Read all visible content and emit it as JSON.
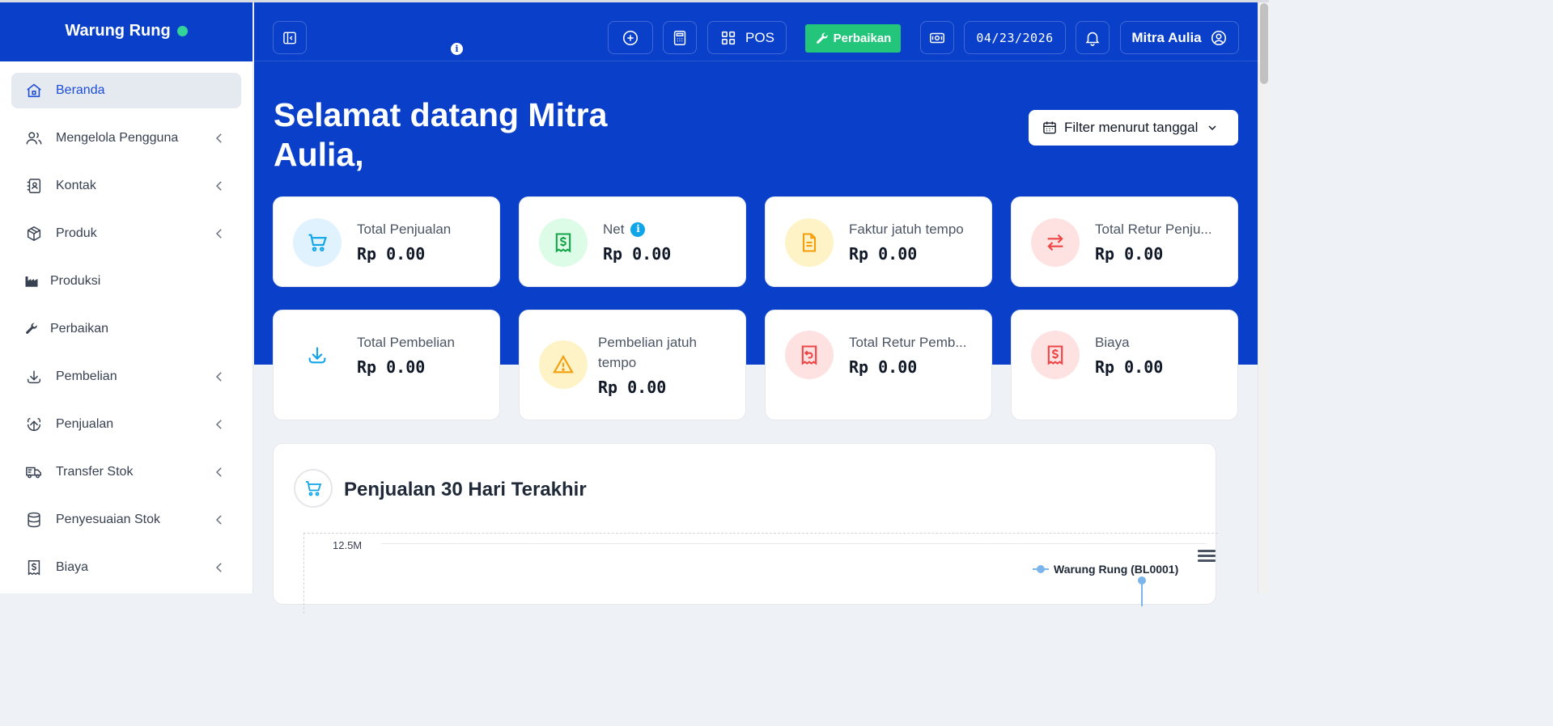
{
  "brand": {
    "name": "Warung Rung",
    "status_color": "#34d399"
  },
  "sidebar": {
    "items": [
      {
        "label": "Beranda",
        "icon": "home-icon",
        "active": true,
        "has_submenu": false
      },
      {
        "label": "Mengelola Pengguna",
        "icon": "users-icon",
        "has_submenu": true
      },
      {
        "label": "Kontak",
        "icon": "contact-book-icon",
        "has_submenu": true
      },
      {
        "label": "Produk",
        "icon": "box-icon",
        "has_submenu": true
      },
      {
        "label": "Produksi",
        "icon": "factory-icon",
        "has_submenu": false
      },
      {
        "label": "Perbaikan",
        "icon": "wrench-icon",
        "has_submenu": false
      },
      {
        "label": "Pembelian",
        "icon": "download-icon",
        "has_submenu": true
      },
      {
        "label": "Penjualan",
        "icon": "upload-icon",
        "has_submenu": true
      },
      {
        "label": "Transfer Stok",
        "icon": "truck-icon",
        "has_submenu": true
      },
      {
        "label": "Penyesuaian Stok",
        "icon": "database-icon",
        "has_submenu": true
      },
      {
        "label": "Biaya",
        "icon": "receipt-dollar-icon",
        "has_submenu": true
      }
    ]
  },
  "topbar": {
    "pos_label": "POS",
    "repair_label": "Perbaikan",
    "date": "04/23/2026",
    "user_name": "Mitra Aulia"
  },
  "hero": {
    "welcome": "Selamat datang Mitra Aulia,",
    "filter_label": "Filter menurut tanggal"
  },
  "cards": [
    {
      "label": "Total Penjualan",
      "value": "Rp 0.00",
      "icon": "cart-icon",
      "color": "#0ea5e9",
      "bg": "#e0f2fe"
    },
    {
      "label": "Net",
      "value": "Rp 0.00",
      "icon": "receipt-dollar-icon",
      "color": "#16a34a",
      "bg": "#dcfce7"
    },
    {
      "label": "Faktur jatuh tempo",
      "value": "Rp 0.00",
      "icon": "document-icon",
      "color": "#f59e0b",
      "bg": "#fef3c7"
    },
    {
      "label": "Total Retur Penju...",
      "value": "Rp 0.00",
      "icon": "exchange-icon",
      "color": "#ef4444",
      "bg": "#fee2e2"
    },
    {
      "label": "Total Pembelian",
      "value": "Rp 0.00",
      "icon": "download-icon",
      "color": "#0ea5e9",
      "bg": "#ffffff"
    },
    {
      "label": "Pembelian jatuh tempo",
      "value": "Rp 0.00",
      "icon": "warning-icon",
      "color": "#f59e0b",
      "bg": "#fef3c7"
    },
    {
      "label": "Total Retur Pemb...",
      "value": "Rp 0.00",
      "icon": "receipt-return-icon",
      "color": "#ef4444",
      "bg": "#fee2e2"
    },
    {
      "label": "Biaya",
      "value": "Rp 0.00",
      "icon": "receipt-dollar-icon",
      "color": "#ef4444",
      "bg": "#fee2e2"
    }
  ],
  "sales_panel": {
    "title": "Penjualan 30 Hari Terakhir",
    "ytick": "12.5M",
    "legend": "Warung Rung (BL0001)",
    "series_color": "#7cb5ec"
  }
}
